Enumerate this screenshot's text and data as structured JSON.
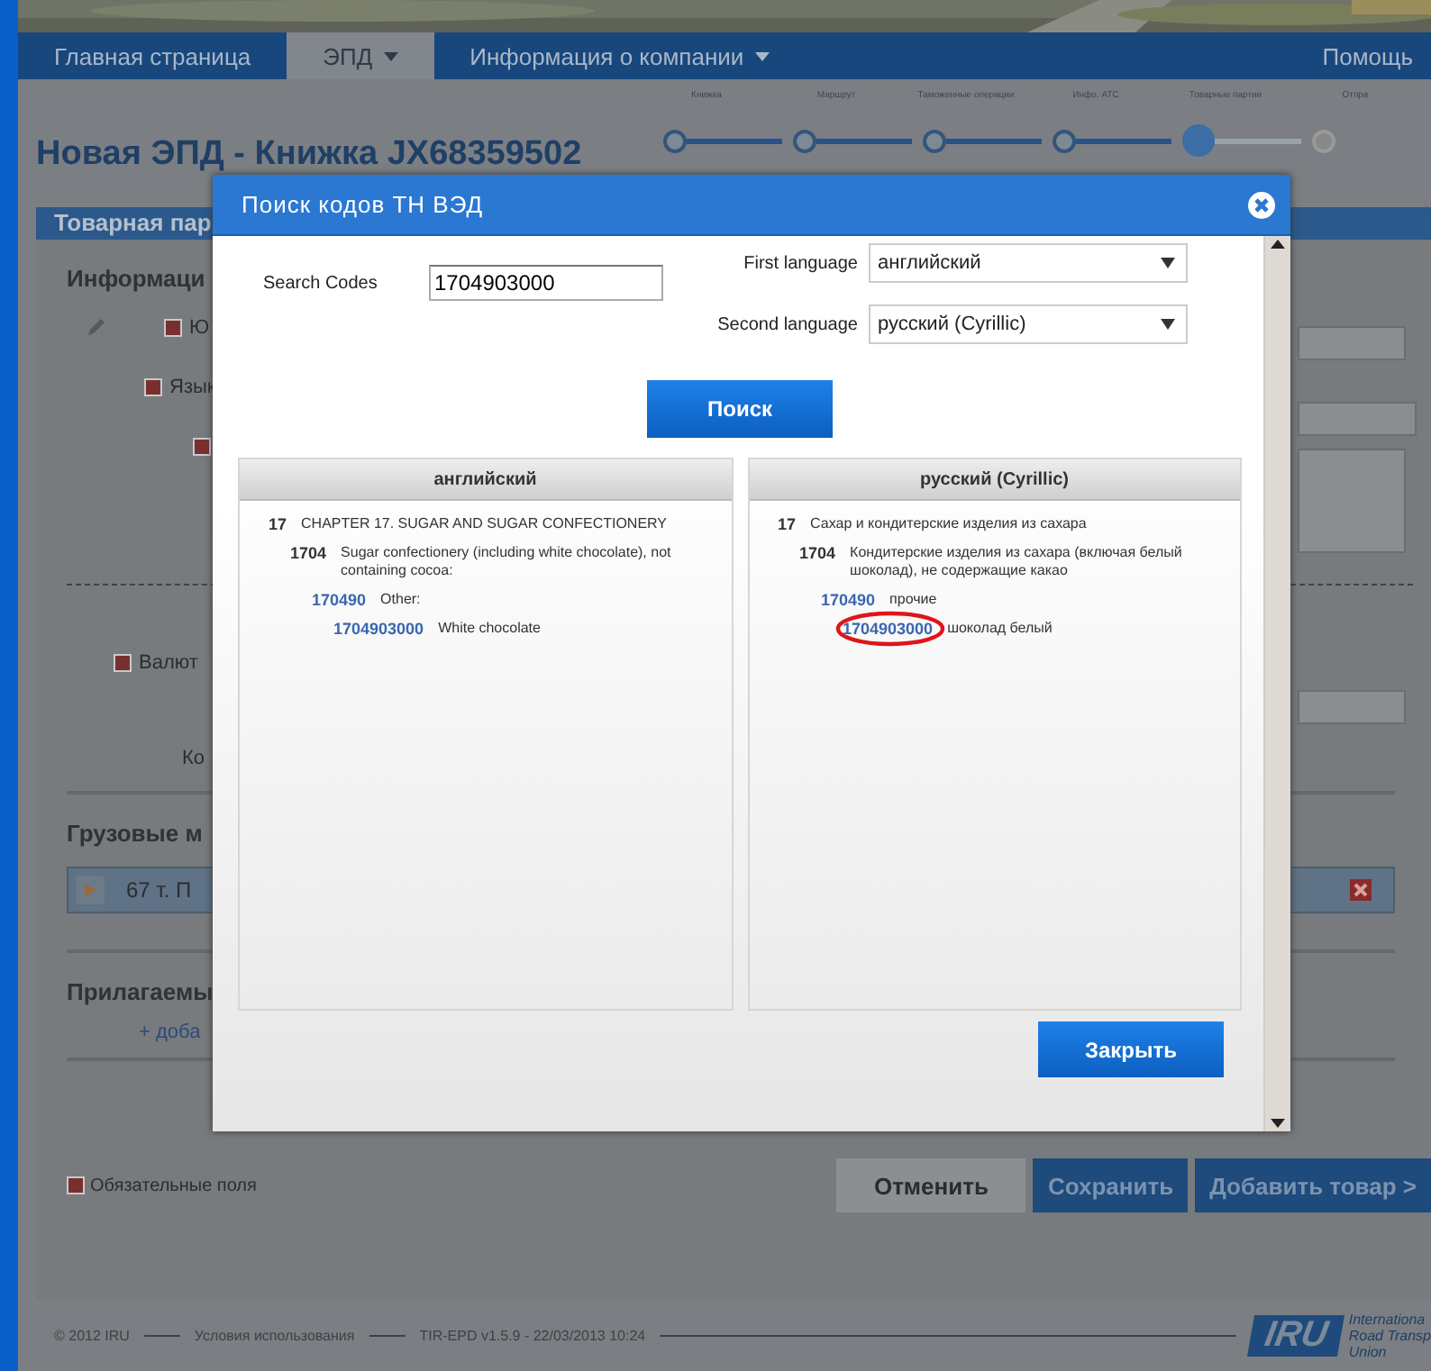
{
  "nav": {
    "items": [
      {
        "label": "Главная страница",
        "selected": false,
        "has_menu": false
      },
      {
        "label": "ЭПД",
        "selected": true,
        "has_menu": true
      },
      {
        "label": "Информация о компании",
        "selected": false,
        "has_menu": true
      }
    ],
    "help": "Помощь"
  },
  "title": "Новая ЭПД - Книжка JX68359502",
  "stepper": [
    {
      "label": "Книжка",
      "done": true,
      "current": false
    },
    {
      "label": "Маршрут",
      "done": true,
      "current": false
    },
    {
      "label": "Таможенные операции",
      "done": true,
      "current": false
    },
    {
      "label": "Инфо. АТС",
      "done": true,
      "current": false
    },
    {
      "label": "Товарные партии",
      "done": false,
      "current": true
    },
    {
      "label": "Отпра",
      "done": false,
      "current": false
    }
  ],
  "panel": {
    "title": "Товарная пар",
    "section": "Информаци",
    "rows": [
      {
        "label": "Ю",
        "required": true,
        "edit": true
      },
      {
        "label": "Язык",
        "required": true,
        "edit": false
      },
      {
        "label": "",
        "required": true,
        "edit": false
      }
    ],
    "currency": {
      "label": "Валют",
      "required": true
    },
    "ko": "Ко",
    "cargo": {
      "title": "Грузовые м",
      "item": "67 т. П"
    },
    "attachments": {
      "title": "Прилагаемы",
      "add_link": "+ доба"
    },
    "required_note": "Обязательные поля",
    "buttons": [
      {
        "label": "Отменить",
        "kind": "secondary"
      },
      {
        "label": "Сохранить",
        "kind": "primary"
      },
      {
        "label": "Добавить товар >",
        "kind": "primary"
      }
    ]
  },
  "footer": {
    "copyright": "© 2012 IRU",
    "terms": "Условия использования",
    "version": "TIR-EPD v1.5.9 - 22/03/2013 10:24",
    "logo": "IRU",
    "org_lines": [
      "Internationa",
      "Road Transp",
      "Union"
    ]
  },
  "dialog": {
    "title": "Поиск кодов ТН ВЭД",
    "search": {
      "label": "Search Codes",
      "value": "1704903000"
    },
    "first_language": {
      "label": "First language",
      "value": "английский"
    },
    "second_language": {
      "label": "Second language",
      "value": "русский (Cyrillic)"
    },
    "search_button": "Поиск",
    "columns": [
      {
        "header": "английский",
        "entries": [
          {
            "code": "17",
            "text": "CHAPTER 17. SUGAR AND SUGAR CONFECTIONERY",
            "highlighted": false,
            "children": [
              {
                "code": "1704",
                "text": "Sugar confectionery (including white chocolate), not containing cocoa:",
                "highlighted": false,
                "children": [
                  {
                    "code": "170490",
                    "text": "Other:",
                    "highlighted": false,
                    "children": [
                      {
                        "code": "1704903000",
                        "text": "White chocolate",
                        "highlighted": false
                      }
                    ]
                  }
                ]
              }
            ]
          }
        ]
      },
      {
        "header": "русский (Cyrillic)",
        "entries": [
          {
            "code": "17",
            "text": "Сахар и кондитерские изделия из сахара",
            "highlighted": false,
            "children": [
              {
                "code": "1704",
                "text": "Кондитерские изделия из сахара (включая белый шоколад), не содержащие какао",
                "highlighted": false,
                "children": [
                  {
                    "code": "170490",
                    "text": "прочие",
                    "highlighted": false,
                    "children": [
                      {
                        "code": "1704903000",
                        "text": "шоколад белый",
                        "highlighted": true
                      }
                    ]
                  }
                ]
              }
            ]
          }
        ]
      }
    ],
    "close_button": "Закрыть"
  }
}
